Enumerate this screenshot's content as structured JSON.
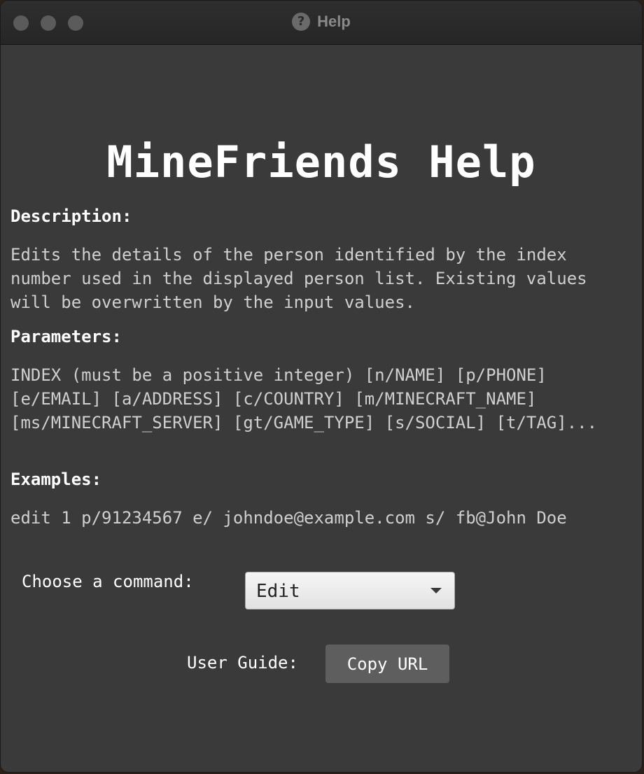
{
  "window": {
    "title": "Help"
  },
  "main": {
    "heading": "MineFriends Help",
    "description_label": "Description:",
    "description_text": "Edits the details of the person identified by the index number used in the displayed person list. Existing values will be overwritten by the input values.",
    "parameters_label": "Parameters:",
    "parameters_text": "INDEX (must be a positive integer) [n/NAME] [p/PHONE] [e/EMAIL] [a/ADDRESS] [c/COUNTRY] [m/MINECRAFT_NAME] [ms/MINECRAFT_SERVER] [gt/GAME_TYPE] [s/SOCIAL] [t/TAG]...",
    "examples_label": "Examples:",
    "examples_text": "edit 1 p/91234567 e/ johndoe@example.com s/ fb@John Doe"
  },
  "command": {
    "label": "Choose a command:",
    "selected": "Edit"
  },
  "guide": {
    "label": "User Guide:",
    "button_label": "Copy URL"
  },
  "colors": {
    "background": "#3a3a3a",
    "titlebar": "#262626",
    "heading_text": "#ffffff",
    "body_text": "#cfcfcf",
    "button": "#5e5e5e"
  },
  "icons": {
    "title_icon": "help-icon"
  }
}
